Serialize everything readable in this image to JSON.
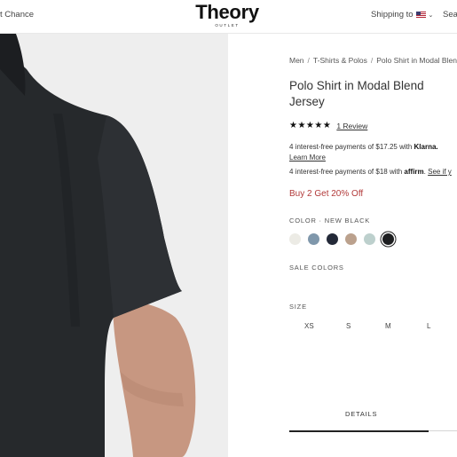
{
  "header": {
    "promo_text": "t Chance",
    "logo_main": "Theory",
    "logo_sub": "OUTLET",
    "shipping_label": "Shipping to",
    "search_label": "Sea"
  },
  "breadcrumb": [
    "Men",
    "T-Shirts & Polos",
    "Polo Shirt in Modal Blend"
  ],
  "product": {
    "title": "Polo Shirt in Modal Blend Jersey",
    "stars": "★★★★★",
    "rating": 5,
    "review_link": "1 Review",
    "klarna_text": "4 interest-free payments of $17.25 with",
    "klarna_brand": "Klarna.",
    "learn_more": "Learn More",
    "affirm_text": "4 interest-free payments of $18 with",
    "affirm_brand": "affirm",
    "affirm_see": "See if y",
    "promo_offer": "Buy 2 Get 20% Off",
    "color_label": "COLOR · NEW BLACK",
    "swatches": [
      {
        "name": "ivory",
        "color": "#ecebe5"
      },
      {
        "name": "slate-blue",
        "color": "#7f97ab"
      },
      {
        "name": "navy",
        "color": "#232938"
      },
      {
        "name": "tan",
        "color": "#bba18d"
      },
      {
        "name": "pale-sage",
        "color": "#bdd0cd"
      },
      {
        "name": "new-black",
        "color": "#1d1e20",
        "selected": true
      }
    ],
    "sale_colors_label": "SALE COLORS",
    "size_label": "SIZE",
    "sizes": [
      "XS",
      "S",
      "M",
      "L"
    ],
    "details_tab": "DETAILS"
  },
  "colors": {
    "promo_red": "#b23a3a",
    "shirt": "#26292c",
    "skin": "#c79781"
  }
}
